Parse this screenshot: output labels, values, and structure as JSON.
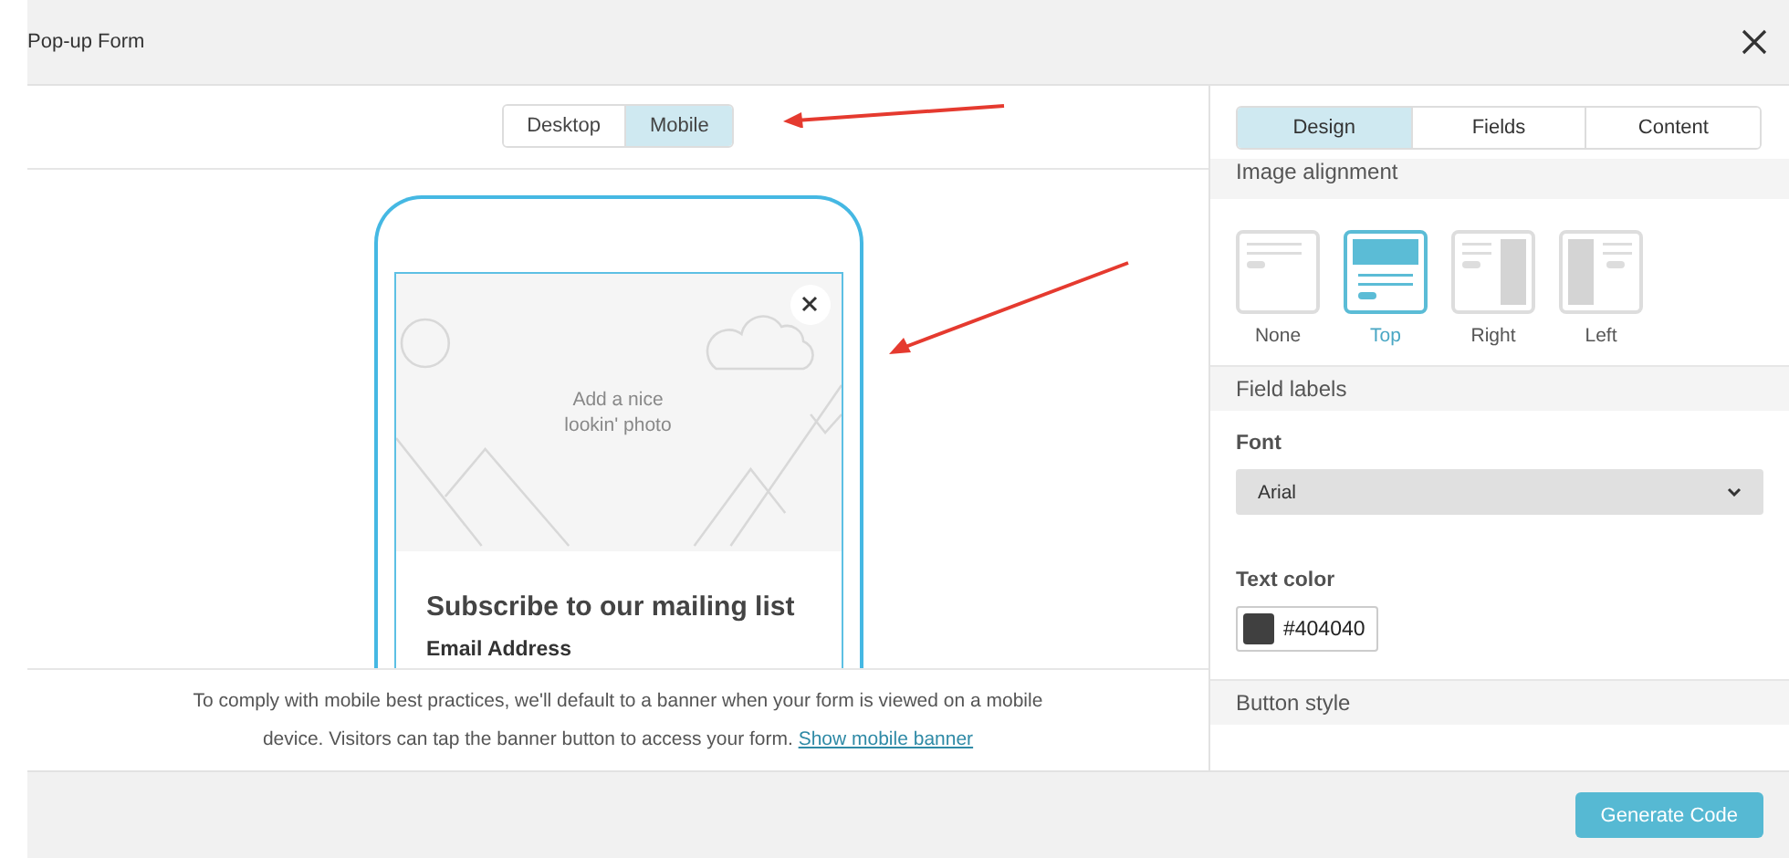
{
  "window": {
    "title": "Pop-up Form"
  },
  "view_toggle": [
    {
      "label": "Desktop",
      "selected": false
    },
    {
      "label": "Mobile",
      "selected": true
    }
  ],
  "preview": {
    "photo_placeholder": "Add a nice lookin' photo",
    "heading": "Subscribe to our mailing list",
    "field_label": "Email Address"
  },
  "notice": {
    "text": "To comply with mobile best practices, we'll default to a banner when your form is viewed on a mobile device. Visitors can tap the banner button to access your form.",
    "link": "Show mobile banner"
  },
  "panel_tabs": [
    {
      "label": "Design",
      "selected": true
    },
    {
      "label": "Fields",
      "selected": false
    },
    {
      "label": "Content",
      "selected": false
    }
  ],
  "sections": [
    {
      "kind": "alignment",
      "title": "Image alignment",
      "options": [
        {
          "kind": "none",
          "label": "None",
          "selected": false
        },
        {
          "kind": "top",
          "label": "Top",
          "selected": true
        },
        {
          "kind": "right",
          "label": "Right",
          "selected": false
        },
        {
          "kind": "left",
          "label": "Left",
          "selected": false
        }
      ]
    },
    {
      "kind": "labels",
      "title": "Field labels",
      "font": {
        "label": "Font",
        "value": "Arial"
      },
      "text_color": {
        "label": "Text color",
        "value": "#404040"
      }
    },
    {
      "kind": "header",
      "title": "Button style"
    }
  ],
  "footer": {
    "button": "Generate Code"
  }
}
